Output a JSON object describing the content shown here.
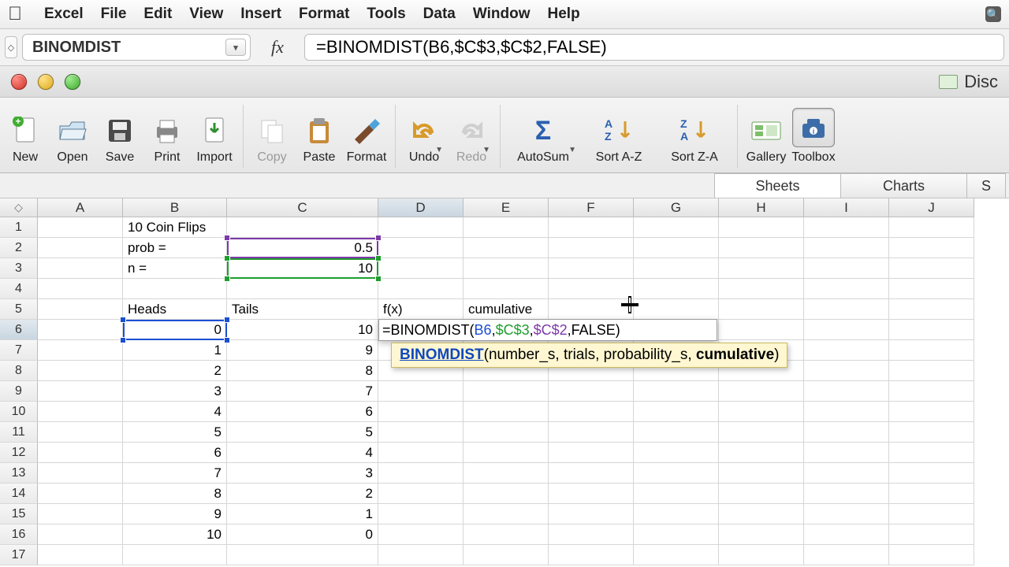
{
  "menu": {
    "app": "Excel",
    "items": [
      "File",
      "Edit",
      "View",
      "Insert",
      "Format",
      "Tools",
      "Data",
      "Window",
      "Help"
    ]
  },
  "formula": {
    "namebox": "BINOMDIST",
    "fx_label": "fx",
    "text": "=BINOMDIST(B6,$C$3,$C$2,FALSE)"
  },
  "window": {
    "truncated_label": "Disc"
  },
  "toolbar": {
    "items": [
      {
        "name": "new",
        "label": "New"
      },
      {
        "name": "open",
        "label": "Open"
      },
      {
        "name": "save",
        "label": "Save"
      },
      {
        "name": "print",
        "label": "Print"
      },
      {
        "name": "import",
        "label": "Import"
      },
      {
        "name": "copy",
        "label": "Copy",
        "dim": true
      },
      {
        "name": "paste",
        "label": "Paste"
      },
      {
        "name": "format",
        "label": "Format"
      },
      {
        "name": "undo",
        "label": "Undo",
        "arrow": true
      },
      {
        "name": "redo",
        "label": "Redo",
        "dim": true,
        "arrow": true
      },
      {
        "name": "autosum",
        "label": "AutoSum",
        "arrow": true
      },
      {
        "name": "sortaz",
        "label": "Sort A-Z"
      },
      {
        "name": "sortza",
        "label": "Sort Z-A"
      },
      {
        "name": "gallery",
        "label": "Gallery"
      },
      {
        "name": "toolbox",
        "label": "Toolbox",
        "active": true
      }
    ]
  },
  "viewtabs": {
    "sheets": "Sheets",
    "charts": "Charts",
    "stub": "S"
  },
  "grid": {
    "cols": [
      "A",
      "B",
      "C",
      "D",
      "E",
      "F",
      "G",
      "H",
      "I",
      "J"
    ],
    "rows": [
      "1",
      "2",
      "3",
      "4",
      "5",
      "6",
      "7",
      "8",
      "9",
      "10",
      "11",
      "12",
      "13",
      "14",
      "15",
      "16",
      "17"
    ],
    "cells": {
      "B1": "10 Coin Flips",
      "B2": "prob =",
      "C2": "0.5",
      "B3": "n =",
      "C3": "10",
      "B5": "Heads",
      "C5": "Tails",
      "D5": "f(x)",
      "E5": "cumulative",
      "B6": "0",
      "C6": "10",
      "B7": "1",
      "C7": "9",
      "B8": "2",
      "C8": "8",
      "B9": "3",
      "C9": "7",
      "B10": "4",
      "C10": "6",
      "B11": "5",
      "C11": "5",
      "B12": "6",
      "C12": "4",
      "B13": "7",
      "C13": "3",
      "B14": "8",
      "C14": "2",
      "B15": "9",
      "C15": "1",
      "B16": "10",
      "C16": "0"
    }
  },
  "editor": {
    "display": {
      "eq": "=",
      "fn": "BINOMDIST",
      "lp": "(",
      "a1": "B6",
      "c": ",",
      "a2": "$C$3",
      "a3": "$C$2",
      "a4": "FALSE",
      "rp": ")"
    },
    "tooltip": {
      "fn": "BINOMDIST",
      "lp": "(",
      "p1": "number_s, trials, probability_s, ",
      "p2": "cumulative",
      "rp": ")"
    }
  },
  "colors": {
    "ref_blue": "#1b4fd1",
    "ref_green": "#1f9d2e",
    "ref_purple": "#7c3aa8"
  }
}
